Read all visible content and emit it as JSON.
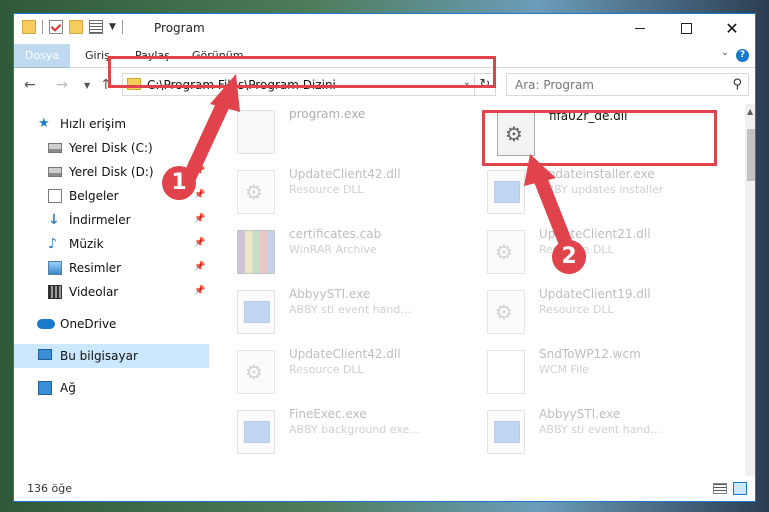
{
  "window": {
    "title": "Program"
  },
  "ribbon": {
    "tabs": [
      "Dosya",
      "Giriş",
      "Paylaş",
      "Görünüm"
    ]
  },
  "navigation": {
    "address": "C:\\Program Files\\Program Dizini",
    "search_placeholder": "Ara: Program"
  },
  "sidebar": {
    "items": [
      {
        "label": "Hızlı erişim",
        "icon": "star-icon"
      },
      {
        "label": "Yerel Disk (C:)",
        "icon": "drive-icon"
      },
      {
        "label": "Yerel Disk (D:)",
        "icon": "drive-icon"
      },
      {
        "label": "Belgeler",
        "icon": "documents-icon"
      },
      {
        "label": "İndirmeler",
        "icon": "download-icon"
      },
      {
        "label": "Müzik",
        "icon": "music-icon"
      },
      {
        "label": "Resimler",
        "icon": "pictures-icon"
      },
      {
        "label": "Videolar",
        "icon": "video-icon"
      },
      {
        "label": "OneDrive",
        "icon": "cloud-icon"
      },
      {
        "label": "Bu bilgisayar",
        "icon": "computer-icon"
      },
      {
        "label": "Ağ",
        "icon": "network-icon"
      }
    ]
  },
  "files": [
    {
      "name": "program.exe",
      "desc": "",
      "icon": "app-icon"
    },
    {
      "name": "fifa02r_de.dll",
      "desc": "",
      "icon": "dll-icon"
    },
    {
      "name": "UpdateClient42.dll",
      "desc": "Resource DLL",
      "icon": "dll-icon"
    },
    {
      "name": "Updateinstaller.exe",
      "desc": "ABBY updates installer",
      "icon": "exe-icon"
    },
    {
      "name": "certificates.cab",
      "desc": "WinRAR Archive",
      "icon": "archive-icon"
    },
    {
      "name": "UpdateClient21.dll",
      "desc": "Resource DLL",
      "icon": "dll-icon"
    },
    {
      "name": "AbbyySTI.exe",
      "desc": "ABBY sti event hand...",
      "icon": "exe-icon"
    },
    {
      "name": "UpdateClient19.dll",
      "desc": "Resource DLL",
      "icon": "dll-icon"
    },
    {
      "name": "UpdateClient42.dll",
      "desc": "Resource DLL",
      "icon": "dll-icon"
    },
    {
      "name": "SndToWP12.wcm",
      "desc": "WCM File",
      "icon": "file-icon"
    },
    {
      "name": "FineExec.exe",
      "desc": "ABBY background exe...",
      "icon": "exe-icon"
    },
    {
      "name": "AbbyySTI.exe",
      "desc": "ABBY sti event hand...",
      "icon": "exe-icon"
    }
  ],
  "status": {
    "item_count": "136 öğe"
  },
  "callouts": [
    "1",
    "2"
  ],
  "colors": {
    "accent": "#1979ca",
    "highlight": "#e0434b",
    "selected_bg": "#cce8ff"
  }
}
